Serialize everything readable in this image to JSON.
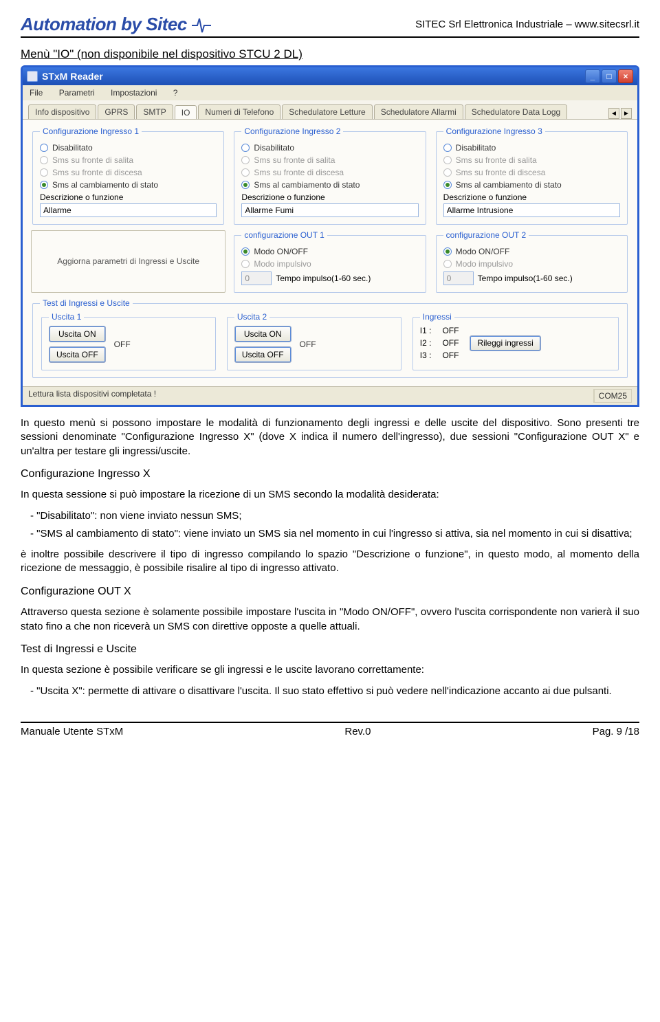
{
  "header": {
    "logo": "Automation by Sitec",
    "right": "SITEC  Srl Elettronica Industriale – www.sitecsrl.it"
  },
  "section_title": "Menù \"IO\" (non disponibile nel dispositivo STCU 2 DL)",
  "window": {
    "title": "STxM  Reader",
    "menu": [
      "File",
      "Parametri",
      "Impostazioni",
      "?"
    ],
    "tabs": [
      "Info dispositivo",
      "GPRS",
      "SMTP",
      "IO",
      "Numeri di Telefono",
      "Schedulatore Letture",
      "Schedulatore Allarmi",
      "Schedulatore Data Logg"
    ],
    "active_tab": "IO",
    "helper_text": "Aggiorna parametri di Ingressi e Uscite",
    "ingresso_labels": {
      "disabilitato": "Disabilitato",
      "salita": "Sms su fronte di salita",
      "discesa": "Sms su fronte di discesa",
      "cambio": "Sms al cambiamento di stato",
      "desc": "Descrizione o funzione"
    },
    "ingressi": [
      {
        "legend": "Configurazione Ingresso 1",
        "value": "Allarme"
      },
      {
        "legend": "Configurazione Ingresso 2",
        "value": "Allarme Fumi"
      },
      {
        "legend": "Configurazione Ingresso 3",
        "value": "Allarme Intrusione"
      }
    ],
    "out_labels": {
      "onoff": "Modo ON/OFF",
      "impulsivo": "Modo impulsivo",
      "tempo": "Tempo impulso(1-60 sec.)",
      "tempo_val": "0"
    },
    "outs": [
      {
        "legend": "configurazione OUT 1"
      },
      {
        "legend": "configurazione OUT 2"
      }
    ],
    "test": {
      "legend": "Test di Ingressi e Uscite",
      "uscita1_legend": "Uscita 1",
      "uscita2_legend": "Uscita 2",
      "ingressi_legend": "Ingressi",
      "btn_on": "Uscita ON",
      "btn_off": "Uscita OFF",
      "state_off": "OFF",
      "i1": "I1 :",
      "i2": "I2 :",
      "i3": "I3 :",
      "rileggi": "Rileggi ingressi"
    },
    "status_left": "Lettura lista dispositivi completata !",
    "status_right": "COM25"
  },
  "doc": {
    "p1": "In questo menù si possono impostare le modalità di funzionamento degli ingressi e delle uscite del dispositivo. Sono presenti tre sessioni denominate \"Configurazione Ingresso X\" (dove X indica il numero dell'ingresso), due sessioni \"Configurazione OUT X\" e un'altra per testare gli ingressi/uscite.",
    "h1": "Configurazione Ingresso X",
    "p2": "In questa sessione si può impostare la ricezione di un SMS secondo la modalità desiderata:",
    "li1": "\"Disabilitato\": non viene inviato nessun SMS;",
    "li2": "\"SMS al cambiamento di stato\": viene inviato un SMS sia nel momento in cui l'ingresso si attiva, sia nel momento in cui si disattiva;",
    "p3": "è inoltre possibile descrivere il tipo di ingresso compilando lo spazio \"Descrizione o funzione\", in questo modo, al momento della ricezione de messaggio, è possibile risalire al tipo di ingresso attivato.",
    "h2": "Configurazione OUT X",
    "p4": "Attraverso questa sezione è solamente possibile impostare l'uscita in \"Modo ON/OFF\", ovvero l'uscita corrispondente non varierà il suo stato fino a che non riceverà un SMS con direttive opposte a quelle attuali.",
    "h3": "Test di Ingressi e Uscite",
    "p5": "In questa sezione è possibile verificare se gli ingressi e le uscite lavorano correttamente:",
    "li3": "\"Uscita X\": permette di attivare o disattivare l'uscita. Il suo stato effettivo si può vedere nell'indicazione accanto ai due pulsanti."
  },
  "footer": {
    "left": "Manuale Utente STxM",
    "center": "Rev.0",
    "right": "Pag.  9 /18"
  }
}
